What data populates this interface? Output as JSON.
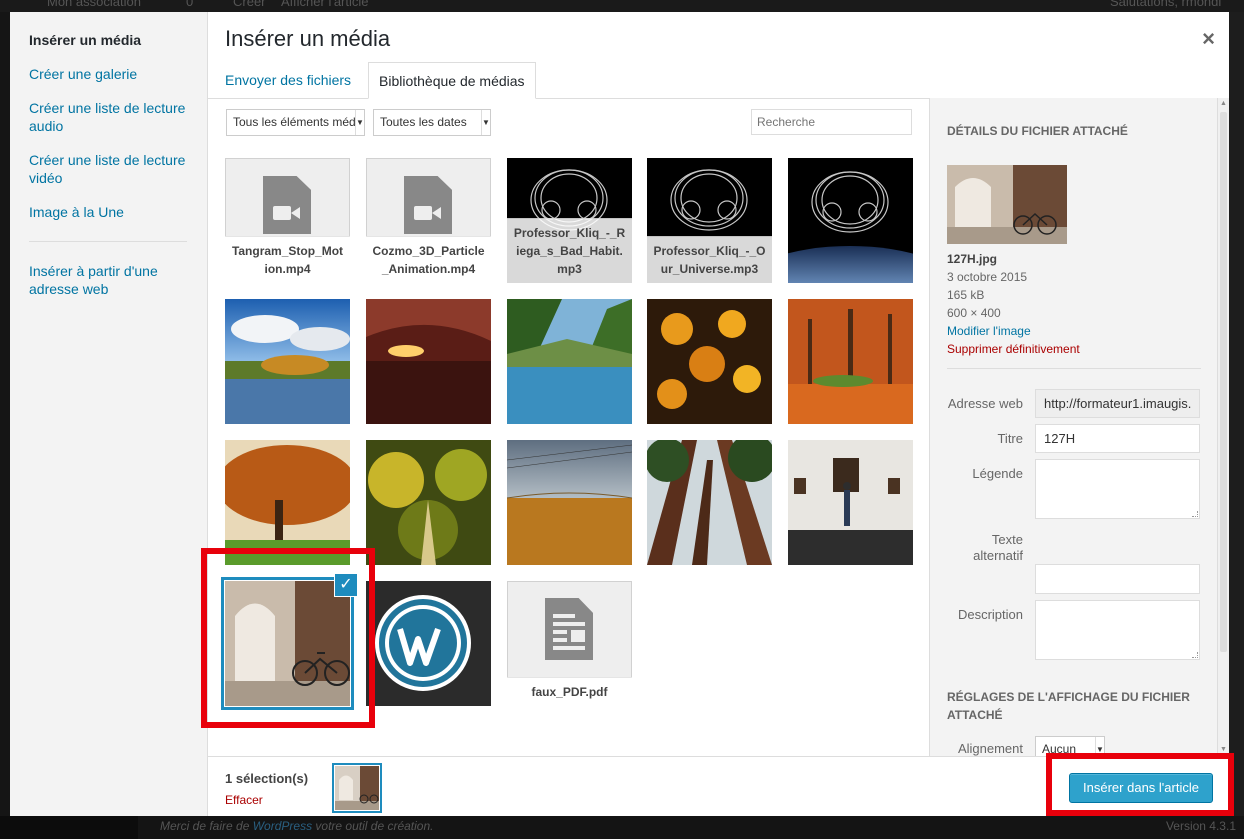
{
  "backdrop": {
    "topbar_items": [
      "Mon association",
      "0",
      "Créer",
      "Afficher l'article",
      "Salutations, rmondi"
    ],
    "footer_text": "Merci de faire de",
    "footer_link": "WordPress",
    "footer_text_after": "votre outil de création.",
    "version": "Version 4.3.1"
  },
  "menu": {
    "items": [
      {
        "label": "Insérer un média",
        "active": true
      },
      {
        "label": "Créer une galerie"
      },
      {
        "label": "Créer une liste de lecture audio"
      },
      {
        "label": "Créer une liste de lecture vidéo"
      },
      {
        "label": "Image à la Une"
      },
      {
        "label": "Insérer à partir d'une adresse web"
      }
    ]
  },
  "frame": {
    "title": "Insérer un média",
    "close_icon": "×"
  },
  "tabs": [
    {
      "label": "Envoyer des fichiers",
      "active": false
    },
    {
      "label": "Bibliothèque de médias",
      "active": true
    }
  ],
  "toolbar": {
    "filter_type": "Tous les éléments média",
    "filter_date": "Toutes les dates",
    "search_placeholder": "Recherche"
  },
  "grid": {
    "items": [
      {
        "filename": "Tangram_Stop_Motion.mp4",
        "type": "video"
      },
      {
        "filename": "Cozmo_3D_Particle_Animation.mp4",
        "type": "video"
      },
      {
        "filename": "Professor_Kliq_-_Riega_s_Bad_Habit.mp3",
        "type": "audio"
      },
      {
        "filename": "Professor_Kliq_-_Our_Universe.mp3",
        "type": "audio"
      },
      {
        "filename": "",
        "type": "image-headphones-earth"
      },
      {
        "filename": "",
        "type": "image-lake-sky"
      },
      {
        "filename": "",
        "type": "image-arch-sunset"
      },
      {
        "filename": "",
        "type": "image-lake-valley"
      },
      {
        "filename": "",
        "type": "image-autumn-leaves"
      },
      {
        "filename": "",
        "type": "image-autumn-park"
      },
      {
        "filename": "",
        "type": "image-autumn-tree"
      },
      {
        "filename": "",
        "type": "image-yellow-forest"
      },
      {
        "filename": "",
        "type": "image-wheat-field"
      },
      {
        "filename": "",
        "type": "image-redwoods"
      },
      {
        "filename": "",
        "type": "image-gallery"
      },
      {
        "filename": "",
        "type": "image-bicycle",
        "selected": true
      },
      {
        "filename": "",
        "type": "image-wordpress"
      },
      {
        "filename": "faux_PDF.pdf",
        "type": "document"
      }
    ]
  },
  "details": {
    "heading": "Détails du fichier attaché",
    "filename": "127H.jpg",
    "date": "3 octobre 2015",
    "size": "165 kB",
    "dimensions": "600 × 400",
    "edit_link": "Modifier l'image",
    "delete_link": "Supprimer définitivement",
    "fields": {
      "url_label": "Adresse web",
      "url_value": "http://formateur1.imaugis.",
      "title_label": "Titre",
      "title_value": "127H",
      "caption_label": "Légende",
      "caption_value": "",
      "alt_label_1": "Texte",
      "alt_label_2": "alternatif",
      "alt_value": "",
      "description_label": "Description",
      "description_value": ""
    },
    "display_heading": "Réglages de l'affichage du fichier attaché",
    "align_label": "Alignement",
    "align_value": "Aucun"
  },
  "selection": {
    "count": "1 sélection(s)",
    "clear": "Effacer"
  },
  "insert_button": "Insérer dans l'article",
  "colors": {
    "accent": "#0074a2",
    "primary_button": "#2ea2cc",
    "selected_border": "#1e8cbe",
    "highlight": "#e8000b",
    "danger": "#aa0000"
  }
}
